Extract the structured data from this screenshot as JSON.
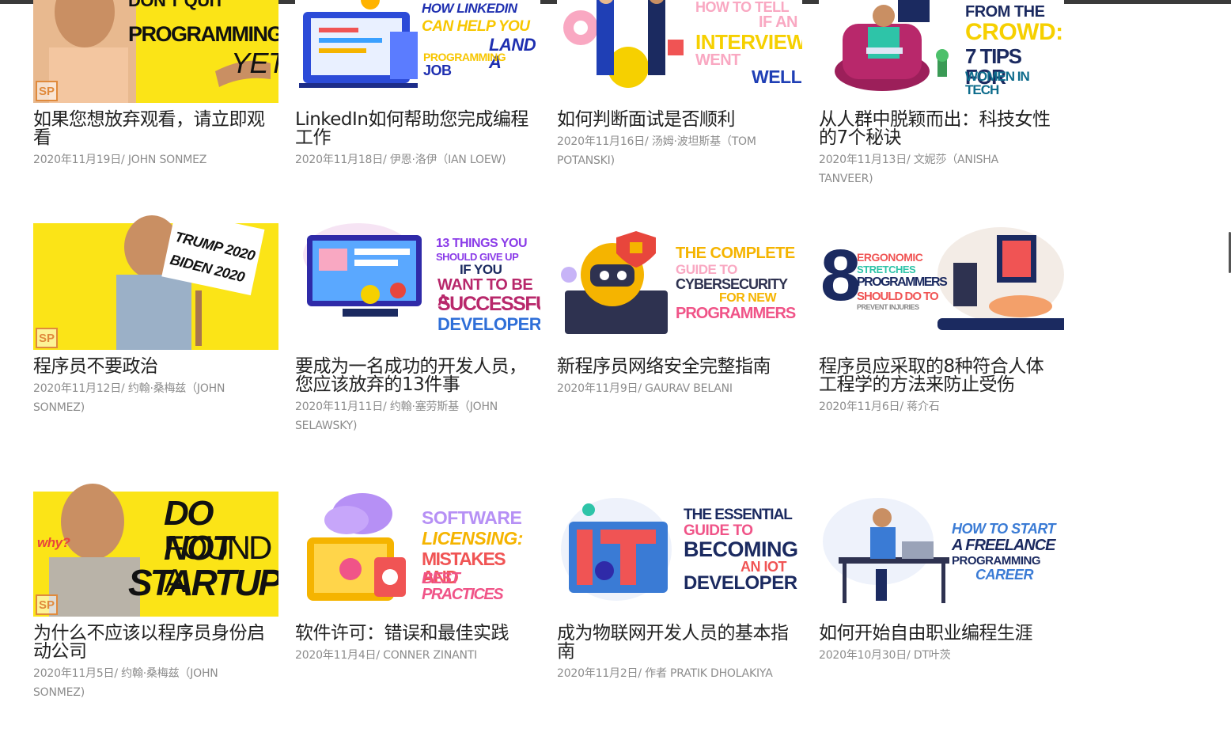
{
  "cards": [
    {
      "title": "如果您想放弃观看，请立即观看",
      "date": "2020年11月19日/",
      "author": "JOHN SONMEZ",
      "image_text": [
        "DON'T QUIT",
        "PROGRAMMING",
        "YET!"
      ],
      "badge": "SP"
    },
    {
      "title": "LinkedIn如何帮助您完成编程工作",
      "date": "2020年11月18日/",
      "author": "伊恩·洛伊（IAN LOEW)",
      "image_text": [
        "HOW LINKEDIN",
        "CAN HELP YOU",
        "LAND A",
        "PROGRAMMING",
        "JOB"
      ]
    },
    {
      "title": "如何判断面试是否顺利",
      "date": "2020年11月16日/",
      "author": "汤姆·波坦斯基（TOM POTANSKI)",
      "image_text": [
        "HOW TO TELL",
        "IF AN",
        "INTERVIEW",
        "WENT",
        "WELL"
      ]
    },
    {
      "title": "从人群中脱颖而出：科技女性的7个秘诀",
      "date": "2020年11月13日/",
      "author": "文妮莎（ANISHA TANVEER)",
      "image_text": [
        "FROM THE",
        "CROWD:",
        "7 TIPS FOR",
        "WOMEN IN TECH"
      ]
    },
    {
      "title": "程序员不要政治",
      "date": "2020年11月12日/",
      "author": "约翰·桑梅兹（JOHN SONMEZ)",
      "image_text": [
        "TRUMP 2020",
        "BIDEN 2020"
      ],
      "badge": "SP"
    },
    {
      "title": "要成为一名成功的开发人员，您应该放弃的13件事",
      "date": "2020年11月11日/",
      "author": "约翰·塞劳斯基（JOHN SELAWSKY)",
      "image_text": [
        "13 THINGS YOU",
        "SHOULD GIVE UP",
        "IF YOU",
        "WANT TO BE A",
        "SUCCESSFUL",
        "DEVELOPER"
      ]
    },
    {
      "title": "新程序员网络安全完整指南",
      "date": "2020年11月9日/",
      "author": "GAURAV BELANI",
      "image_text": [
        "THE COMPLETE",
        "GUIDE TO",
        "CYBERSECURITY",
        "FOR NEW",
        "PROGRAMMERS"
      ]
    },
    {
      "title": "程序员应采取的8种符合人体工程学的方法来防止受伤",
      "date": "2020年11月6日/",
      "author": "蒋介石",
      "image_text": [
        "8",
        "ERGONOMIC",
        "STRETCHES",
        "PROGRAMMERS",
        "SHOULD DO TO",
        "PREVENT INJURIES"
      ]
    },
    {
      "title": "为什么不应该以程序员身份启动公司",
      "date": "2020年11月5日/",
      "author": "约翰·桑梅兹（JOHN SONMEZ)",
      "image_text": [
        "why?",
        "DO NOT",
        "FOUND A",
        "STARTUP!"
      ],
      "badge": "SP"
    },
    {
      "title": "软件许可：错误和最佳实践",
      "date": "2020年11月4日/",
      "author": "CONNER ZINANTI",
      "image_text": [
        "SOFTWARE",
        "LICENSING:",
        "MISTAKES AND",
        "BEST PRACTICES"
      ]
    },
    {
      "title": "成为物联网开发人员的基本指南",
      "date": "2020年11月2日/",
      "author": "作者 PRATIK DHOLAKIYA",
      "image_text": [
        "THE ESSENTIAL",
        "GUIDE TO",
        "BECOMING",
        "AN IOT",
        "DEVELOPER"
      ]
    },
    {
      "title": "如何开始自由职业编程生涯",
      "date": "2020年10月30日/",
      "author": "DT叶茨",
      "image_text": [
        "HOW TO START",
        "A FREELANCE",
        "PROGRAMMING",
        "CAREER"
      ]
    }
  ],
  "colors": {
    "title": "#222222",
    "meta": "#8c8c8c",
    "yellow": "#fbe417",
    "badge": "#e08a3c"
  }
}
